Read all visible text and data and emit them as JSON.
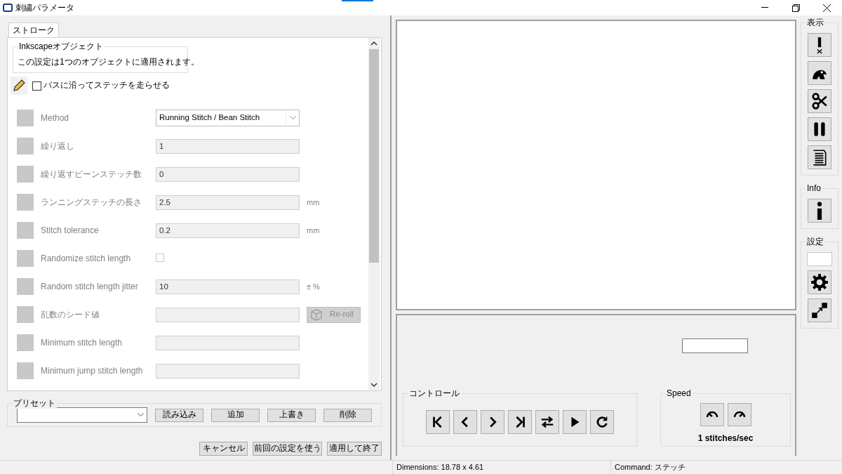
{
  "window": {
    "title": "刺繍パラメータ"
  },
  "tabs": [
    {
      "label": "ストローク",
      "selected": true
    }
  ],
  "object_group": {
    "title": "Inkscapeオブジェクト",
    "text": "この設定は1つのオブジェクトに適用されます。"
  },
  "main_toggle": {
    "label": "パスに沿ってステッチを走らせる",
    "checked": false
  },
  "params": [
    {
      "kind": "select",
      "label": "Method",
      "value": "Running Stitch / Bean Stitch"
    },
    {
      "kind": "field",
      "label": "繰り返し",
      "value": "1"
    },
    {
      "kind": "field",
      "label": "繰り返すビーンステッチ数",
      "value": "0"
    },
    {
      "kind": "field",
      "label": "ランニングステッチの長さ",
      "value": "2.5",
      "unit": "mm"
    },
    {
      "kind": "field",
      "label": "Stitch tolerance",
      "value": "0.2",
      "unit": "mm"
    },
    {
      "kind": "checkbox",
      "label": "Randomize stitch length",
      "checked": false
    },
    {
      "kind": "field",
      "label": "Random stitch length jitter",
      "value": "10",
      "unit": "± %"
    },
    {
      "kind": "field",
      "label": "乱数のシード値",
      "button": "Re-roll"
    },
    {
      "kind": "field",
      "label": "Minimum stitch length"
    },
    {
      "kind": "field",
      "label": "Minimum jump stitch length"
    }
  ],
  "presets": {
    "title": "プリセット",
    "buttons": [
      "読み込み",
      "追加",
      "上書き",
      "削除"
    ]
  },
  "dialog_buttons": [
    "キャンセル",
    "前回の設定を使う",
    "適用して終了"
  ],
  "controls": {
    "title": "コントロール"
  },
  "speed": {
    "title": "Speed",
    "reading": "1 stitches/sec"
  },
  "toolbar_groups": [
    {
      "title": "表示"
    },
    {
      "title": "Info"
    },
    {
      "title": "設定"
    }
  ],
  "status_bar": {
    "dimensions": "Dimensions: 18.78 x 4.61",
    "command": "Command: ステッチ"
  }
}
